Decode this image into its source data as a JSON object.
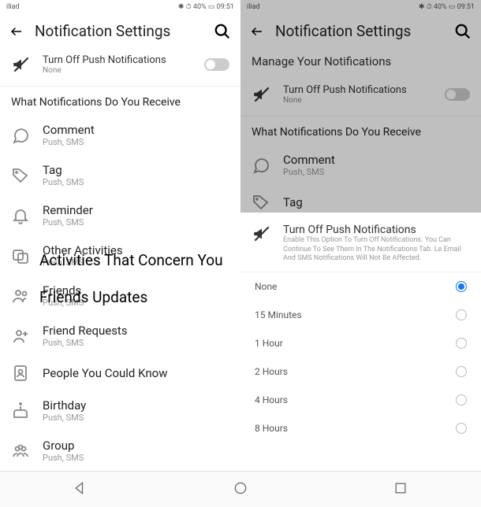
{
  "status": {
    "carrier": "iliad",
    "signal_icons": "📶 📡",
    "right": "✱ ⏱ 40% ▭ 09:51"
  },
  "left": {
    "header": "Notification Settings",
    "push": {
      "title": "Turn Off Push Notifications",
      "sub": "None"
    },
    "section": "What Notifications Do You Receive",
    "items": [
      {
        "title": "Comment",
        "sub": "Push, SMS"
      },
      {
        "title": "Tag",
        "sub": "Push, SMS"
      },
      {
        "title": "Reminder",
        "sub": "Push, SMS"
      },
      {
        "title": "Other Activities",
        "sub": "Push, SMS"
      },
      {
        "title": "Friends",
        "sub": "Push, SMS"
      },
      {
        "title": "Friend Requests",
        "sub": "Push, SMS"
      },
      {
        "title": "People You Could Know",
        "sub": ""
      },
      {
        "title": "Birthday",
        "sub": "Push, SMS"
      },
      {
        "title": "Group",
        "sub": "Push, SMS"
      }
    ],
    "overlay1": "Activities That Concern You",
    "overlay2": "Friends Updates"
  },
  "right": {
    "header": "Notification Settings",
    "manage": "Manage Your Notifications",
    "push": {
      "title": "Turn Off Push Notifications",
      "sub": "None"
    },
    "section": "What Notifications Do You Receive",
    "items": [
      {
        "title": "Comment",
        "sub": "Push, SMS"
      },
      {
        "title": "Tag",
        "sub": ""
      }
    ]
  },
  "sheet": {
    "title": "Turn Off Push Notifications",
    "desc": "Enable This Option To Turn Off Notifications. You Can Continue To See Them In The Notifications Tab. Le Email And SMS Notifications Will Not Be Affected.",
    "options": [
      {
        "label": "None",
        "selected": true
      },
      {
        "label": "15 Minutes",
        "selected": false
      },
      {
        "label": "1 Hour",
        "selected": false
      },
      {
        "label": "2 Hours",
        "selected": false
      },
      {
        "label": "4 Hours",
        "selected": false
      },
      {
        "label": "8 Hours",
        "selected": false
      }
    ]
  }
}
